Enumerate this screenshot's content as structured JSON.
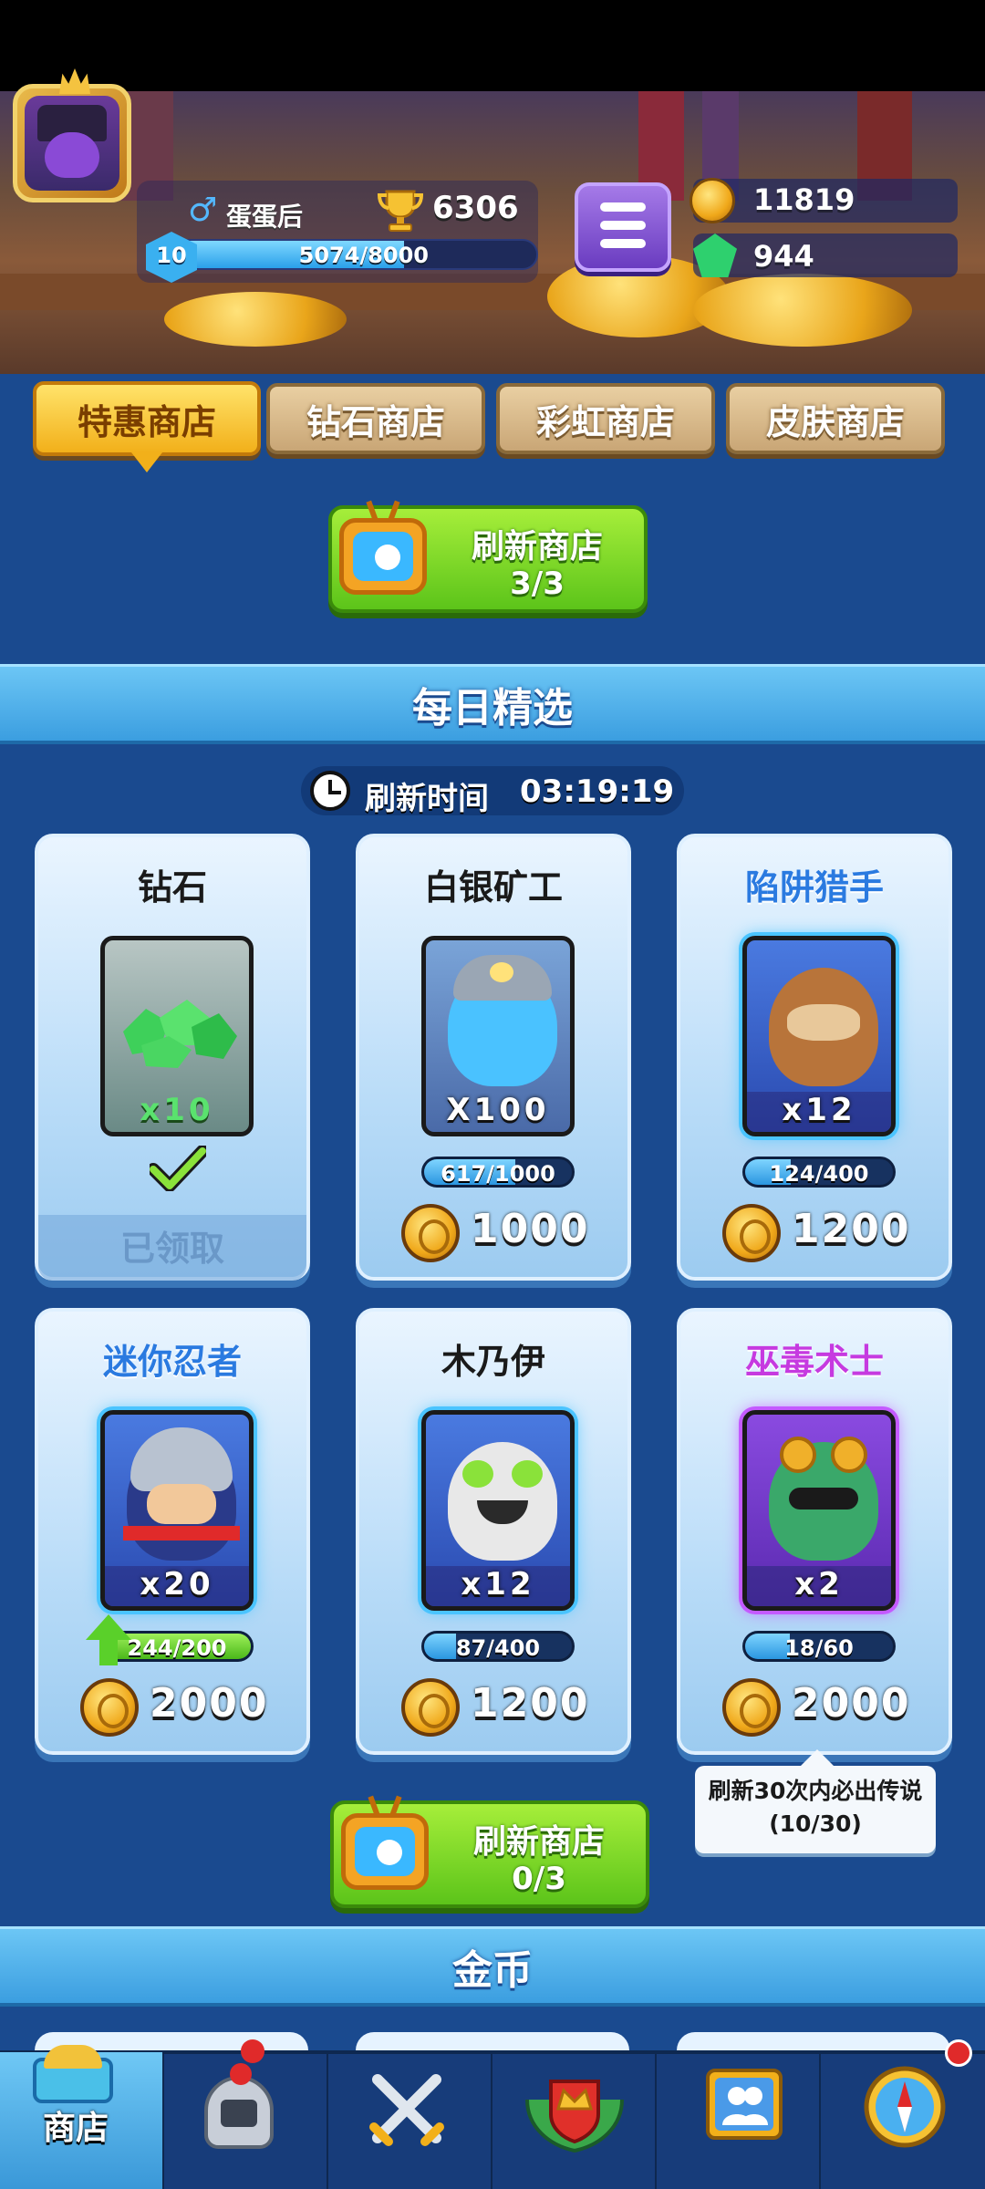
{
  "player": {
    "name": "蛋蛋后",
    "gender_symbol": "♂",
    "level": "10",
    "xp_text": "5074/8000",
    "xp_fraction": 0.634,
    "trophies": "6306"
  },
  "resources": {
    "coins": "11819",
    "gems": "944"
  },
  "tabs": [
    {
      "label": "特惠商店",
      "active": true
    },
    {
      "label": "钻石商店",
      "active": false
    },
    {
      "label": "彩虹商店",
      "active": false
    },
    {
      "label": "皮肤商店",
      "active": false
    }
  ],
  "refresh_top": {
    "label": "刷新商店",
    "count": "3/3"
  },
  "daily": {
    "header": "每日精选",
    "refresh_label": "刷新时间",
    "refresh_time": "03:19:19"
  },
  "cards": [
    {
      "title": "钻石",
      "qty": "x10",
      "status": "已领取"
    },
    {
      "title": "白银矿工",
      "qty": "X100",
      "progress_text": "617/1000",
      "progress": 0.617,
      "price": "1000"
    },
    {
      "title": "陷阱猎手",
      "qty": "x12",
      "progress_text": "124/400",
      "progress": 0.31,
      "price": "1200"
    },
    {
      "title": "迷你忍者",
      "qty": "x20",
      "progress_text": "244/200",
      "progress": 1.0,
      "price": "2000"
    },
    {
      "title": "木乃伊",
      "qty": "x12",
      "progress_text": "87/400",
      "progress": 0.2175,
      "price": "1200"
    },
    {
      "title": "巫毒术士",
      "qty": "x2",
      "progress_text": "18/60",
      "progress": 0.3,
      "price": "2000"
    }
  ],
  "tooltip": {
    "line1": "刷新30次内必出传说",
    "line2": "(10/30)"
  },
  "refresh_bottom": {
    "label": "刷新商店",
    "count": "0/3"
  },
  "coins_section": {
    "header": "金币"
  },
  "nav": {
    "shop_label": "商店",
    "items": [
      "shop",
      "knight",
      "battle",
      "clan-crown",
      "social",
      "compass"
    ]
  },
  "colors": {
    "background": "#1a4a8f",
    "tab_active": "#f2b01a",
    "green_button": "#5cc41a",
    "section_header": "#3b9ee0"
  }
}
